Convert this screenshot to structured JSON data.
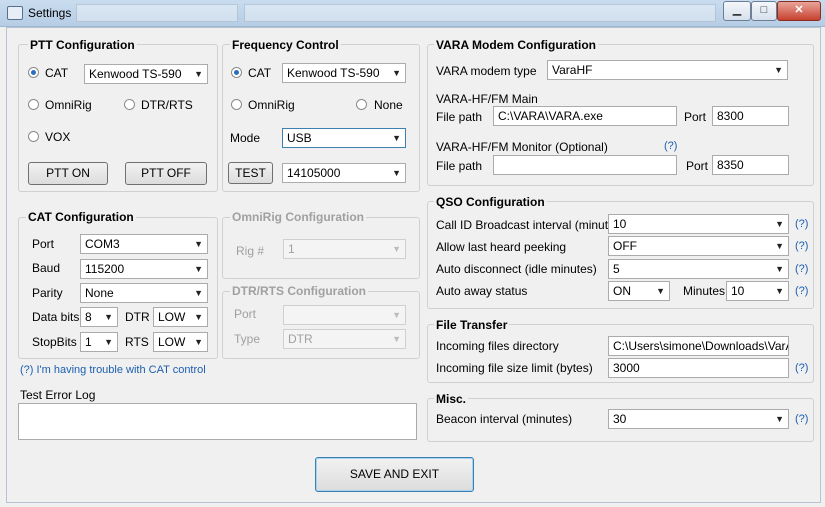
{
  "window": {
    "title": "Settings",
    "buttons": {
      "minimize": "▁",
      "maximize": "□",
      "close": "✕"
    }
  },
  "ptt": {
    "title": "PTT Configuration",
    "cat_label": "CAT",
    "cat_value": "Kenwood TS-590",
    "omnirig_label": "OmniRig",
    "dtrrts_label": "DTR/RTS",
    "vox_label": "VOX",
    "on_button": "PTT ON",
    "off_button": "PTT OFF"
  },
  "frequency": {
    "title": "Frequency Control",
    "cat_label": "CAT",
    "cat_value": "Kenwood TS-590",
    "omnirig_label": "OmniRig",
    "none_label": "None",
    "mode_label": "Mode",
    "mode_value": "USB",
    "test_button": "TEST",
    "freq_value": "14105000"
  },
  "cat": {
    "title": "CAT Configuration",
    "port_label": "Port",
    "port_value": "COM3",
    "baud_label": "Baud",
    "baud_value": "115200",
    "parity_label": "Parity",
    "parity_value": "None",
    "databits_label": "Data bits",
    "databits_value": "8",
    "dtr_label": "DTR",
    "dtr_value": "LOW",
    "stopbits_label": "StopBits",
    "stopbits_value": "1",
    "rts_label": "RTS",
    "rts_value": "LOW",
    "help_link": "(?) I'm having trouble with CAT control"
  },
  "omnirig": {
    "title": "OmniRig Configuration",
    "rig_label": "Rig #",
    "rig_value": "1"
  },
  "dtrrts": {
    "title": "DTR/RTS Configuration",
    "port_label": "Port",
    "port_value": "",
    "type_label": "Type",
    "type_value": "DTR"
  },
  "errorlog": {
    "label": "Test Error Log",
    "value": ""
  },
  "vara": {
    "title": "VARA Modem Configuration",
    "type_label": "VARA modem type",
    "type_value": "VaraHF",
    "main_label": "VARA-HF/FM Main",
    "main_path_label": "File path",
    "main_path_value": "C:\\VARA\\VARA.exe",
    "main_port_label": "Port",
    "main_port_value": "8300",
    "monitor_label": "VARA-HF/FM Monitor (Optional)",
    "monitor_help": "(?)",
    "monitor_path_label": "File path",
    "monitor_path_value": "",
    "monitor_port_label": "Port",
    "monitor_port_value": "8350"
  },
  "qso": {
    "title": "QSO Configuration",
    "callid_label": "Call ID Broadcast interval (minutes)",
    "callid_value": "10",
    "peek_label": "Allow last heard peeking",
    "peek_value": "OFF",
    "autodisc_label": "Auto disconnect (idle minutes)",
    "autodisc_value": "5",
    "away_label": "Auto away status",
    "away_value": "ON",
    "minutes_label": "Minutes",
    "minutes_value": "10",
    "help": "(?)"
  },
  "filetransfer": {
    "title": "File Transfer",
    "dir_label": "Incoming files directory",
    "dir_value": "C:\\Users\\simone\\Downloads\\VarAC\\",
    "limit_label": "Incoming file size limit (bytes)",
    "limit_value": "3000",
    "help": "(?)"
  },
  "misc": {
    "title": "Misc.",
    "beacon_label": "Beacon interval (minutes)",
    "beacon_value": "30",
    "help": "(?)"
  },
  "footer": {
    "save_button": "SAVE AND EXIT"
  }
}
